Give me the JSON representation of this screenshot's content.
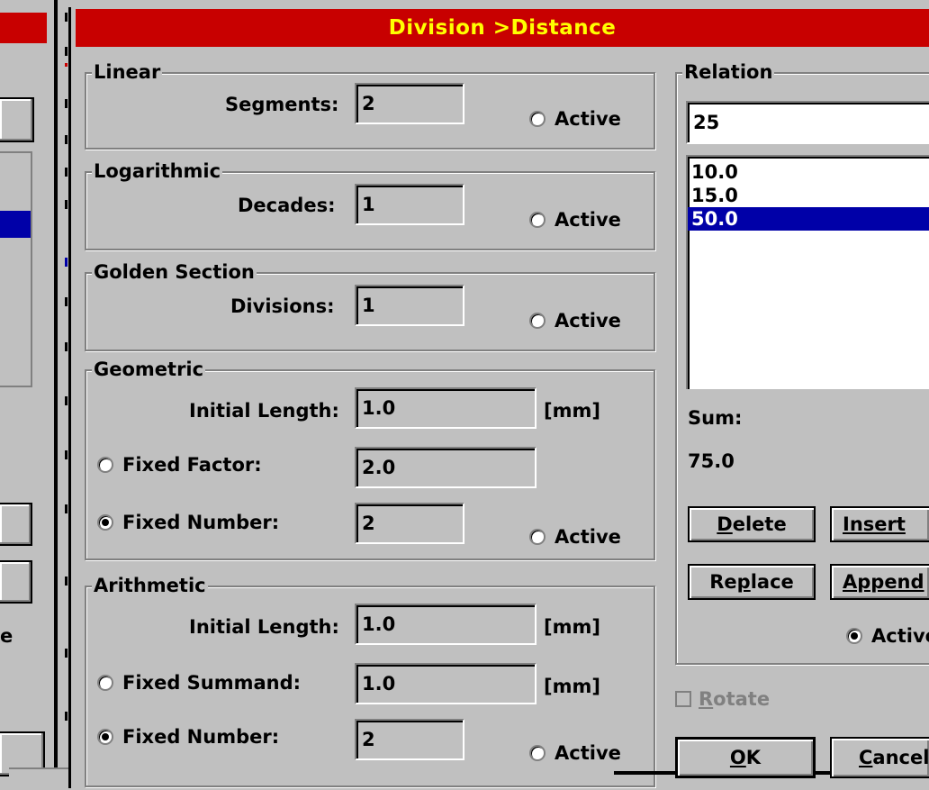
{
  "window_title": "Division >Distance",
  "background_window": {
    "partial_label": "e"
  },
  "linear": {
    "group_label": "Linear",
    "segments_label": "Segments:",
    "segments_value": "2",
    "active_label": "Active",
    "active_selected": false
  },
  "logarithmic": {
    "group_label": "Logarithmic",
    "decades_label": "Decades:",
    "decades_value": "1",
    "active_label": "Active",
    "active_selected": false
  },
  "golden_section": {
    "group_label": "Golden Section",
    "divisions_label": "Divisions:",
    "divisions_value": "1",
    "active_label": "Active",
    "active_selected": false
  },
  "geometric": {
    "group_label": "Geometric",
    "initial_length_label": "Initial Length:",
    "initial_length_value": "1.0",
    "initial_length_unit": "[mm]",
    "fixed_factor_label": "Fixed Factor:",
    "fixed_factor_value": "2.0",
    "fixed_factor_selected": false,
    "fixed_number_label": "Fixed Number:",
    "fixed_number_value": "2",
    "fixed_number_selected": true,
    "active_label": "Active",
    "active_selected": false
  },
  "arithmetic": {
    "group_label": "Arithmetic",
    "initial_length_label": "Initial Length:",
    "initial_length_value": "1.0",
    "initial_length_unit": "[mm]",
    "fixed_summand_label": "Fixed Summand:",
    "fixed_summand_value": "1.0",
    "fixed_summand_unit": "[mm]",
    "fixed_summand_selected": false,
    "fixed_number_label": "Fixed Number:",
    "fixed_number_value": "2",
    "fixed_number_selected": true,
    "active_label": "Active",
    "active_selected": false
  },
  "relation": {
    "group_label": "Relation",
    "input_value": "25",
    "items": [
      "10.0",
      "15.0",
      "50.0"
    ],
    "selected_index": 2,
    "sum_label": "Sum:",
    "sum_value": "75.0",
    "buttons": {
      "delete_rest": "elete",
      "delete_mnemonic": "D",
      "insert": "Insert",
      "replace_pre": "Re",
      "replace_mnemonic": "p",
      "replace_rest": "lace",
      "append": "Append"
    },
    "active_label": "Active",
    "active_selected": true
  },
  "rotate": {
    "mnemonic": "R",
    "rest": "otate",
    "checked": false,
    "enabled": false
  },
  "ok_button": {
    "mnemonic": "O",
    "rest": "K"
  },
  "cancel_button": {
    "mnemonic": "C",
    "rest": "ancel"
  },
  "colors": {
    "title_bar": "#c80000",
    "title_text": "#ffff00",
    "selection": "#0000a8",
    "face": "#c0c0c0"
  }
}
